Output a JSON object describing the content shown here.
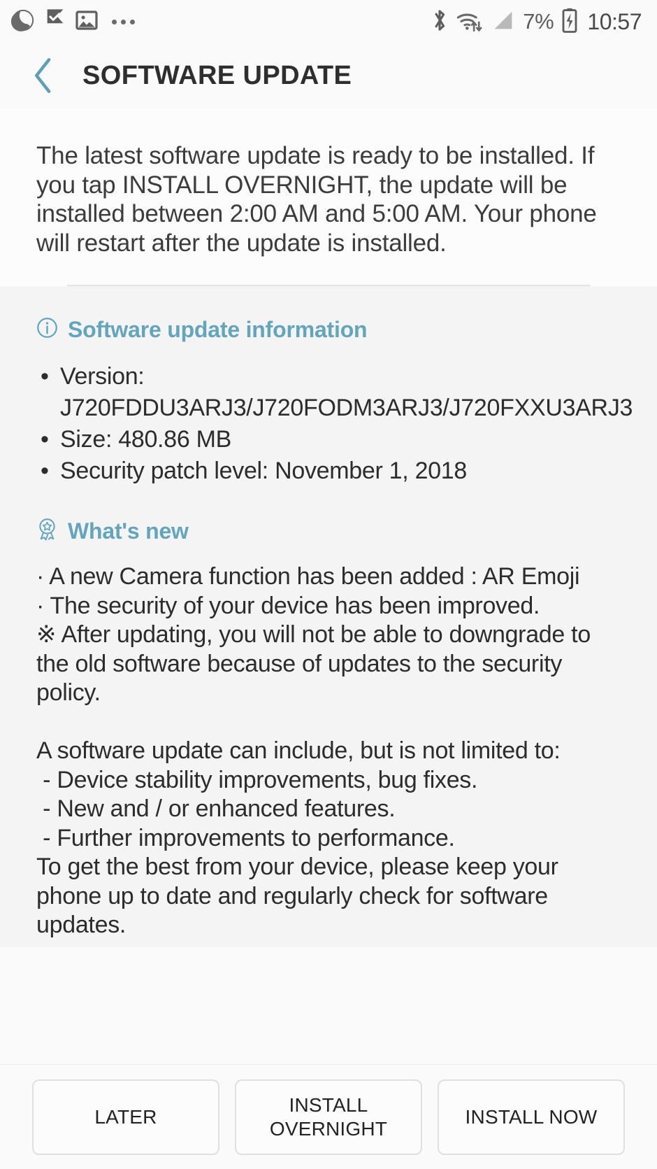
{
  "status_bar": {
    "icons_left": [
      "do-not-disturb-moon-icon",
      "checkmark-flag-icon",
      "gallery-image-icon",
      "more-notifications-dots"
    ],
    "icons_right": [
      "bluetooth-icon",
      "wifi-icon",
      "signal-strength-icon",
      "battery-charging-icon"
    ],
    "battery_percent": "7%",
    "clock": "10:57"
  },
  "app_bar": {
    "back_icon": "chevron-left-icon",
    "title": "SOFTWARE UPDATE"
  },
  "intro": {
    "text": "The latest software update is ready to be installed. If you tap INSTALL OVERNIGHT, the update will be installed between 2:00 AM and 5:00 AM. Your phone will restart after the update is installed."
  },
  "update_info": {
    "icon": "info-circle-icon",
    "heading": "Software update information",
    "items": [
      "Version: J720FDDU3ARJ3/J720FODM3ARJ3/J720FXXU3ARJ3",
      "Size: 480.86 MB",
      "Security patch level: November 1, 2018"
    ]
  },
  "whats_new": {
    "icon": "award-badge-icon",
    "heading": "What's new",
    "body": "· A new Camera function has been added : AR Emoji\n· The security of your device has been improved.\n※ After updating, you will not be able to downgrade to the old software because of updates to the security policy.\n\nA software update can include, but is not limited to:\n - Device stability improvements, bug fixes.\n - New and / or enhanced features.\n - Further improvements to performance.\nTo get the best from your device, please keep your phone up to date and regularly check for software updates."
  },
  "buttons": {
    "later": "LATER",
    "install_overnight": "INSTALL\nOVERNIGHT",
    "install_now": "INSTALL NOW"
  },
  "colors": {
    "accent_teal": "#64a5bb",
    "back_chevron": "#5fa0b4",
    "page_bg": "#fafafa",
    "info_bg": "#f4f4f4",
    "text_primary": "#2c2c2c"
  }
}
